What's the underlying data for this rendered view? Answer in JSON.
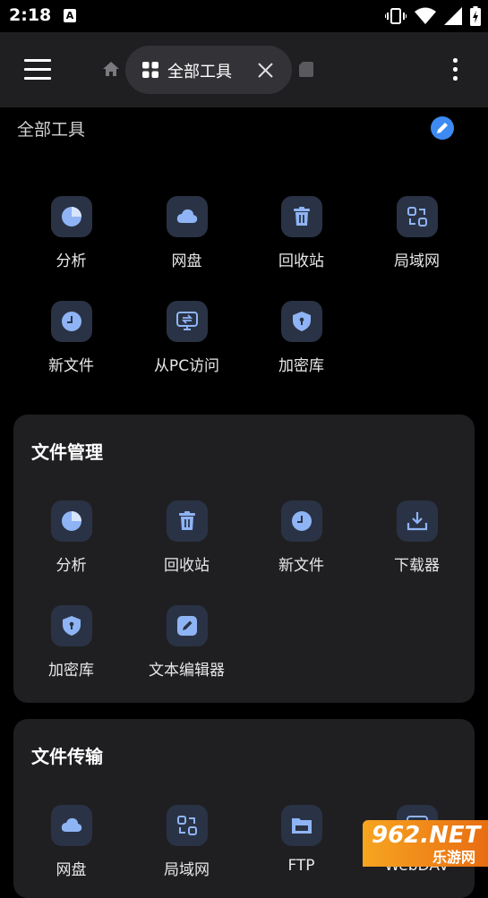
{
  "status_bar": {
    "time": "2:18",
    "app_indicator": "A"
  },
  "toolbar": {
    "tab_label": "全部工具"
  },
  "header": {
    "title": "全部工具"
  },
  "quick_tools": [
    {
      "label": "分析",
      "icon": "pie-chart-icon"
    },
    {
      "label": "网盘",
      "icon": "cloud-icon"
    },
    {
      "label": "回收站",
      "icon": "trash-icon"
    },
    {
      "label": "局域网",
      "icon": "lan-icon"
    },
    {
      "label": "新文件",
      "icon": "clock-icon"
    },
    {
      "label": "从PC访问",
      "icon": "pc-transfer-icon"
    },
    {
      "label": "加密库",
      "icon": "shield-icon"
    }
  ],
  "file_management": {
    "title": "文件管理",
    "tools": [
      {
        "label": "分析",
        "icon": "pie-chart-icon"
      },
      {
        "label": "回收站",
        "icon": "trash-icon"
      },
      {
        "label": "新文件",
        "icon": "clock-icon"
      },
      {
        "label": "下载器",
        "icon": "download-icon"
      },
      {
        "label": "加密库",
        "icon": "shield-icon"
      },
      {
        "label": "文本编辑器",
        "icon": "edit-icon"
      }
    ]
  },
  "file_transfer": {
    "title": "文件传输",
    "tools": [
      {
        "label": "网盘",
        "icon": "cloud-icon"
      },
      {
        "label": "局域网",
        "icon": "lan-icon"
      },
      {
        "label": "FTP",
        "icon": "ftp-folder-icon"
      },
      {
        "label": "WebDAV",
        "icon": "webdav-icon"
      }
    ]
  },
  "watermark": {
    "brand": "962.NET",
    "sub": "乐游网"
  },
  "colors": {
    "background": "#000000",
    "card": "#1f1f22",
    "icon_tile": "#2a3345",
    "icon_accent": "#8fb4f5",
    "edit_accent": "#3d8bf2"
  }
}
